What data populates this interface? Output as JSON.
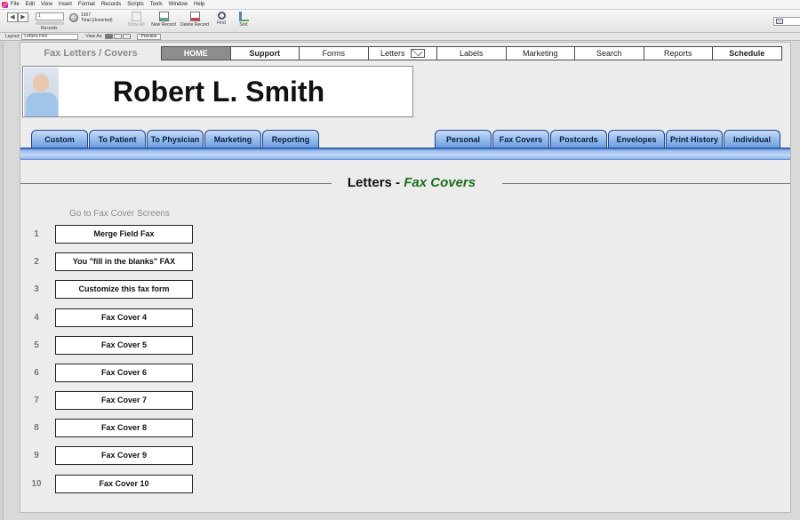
{
  "menu": [
    "File",
    "Edit",
    "View",
    "Insert",
    "Format",
    "Records",
    "Scripts",
    "Tools",
    "Window",
    "Help"
  ],
  "toolbar": {
    "record_number": "1",
    "records_label": "Records",
    "total_count": "1007",
    "total_label": "Total (Unsorted)",
    "show_all": "Show All",
    "new_record": "New Record",
    "delete_record": "Delete Record",
    "find": "Find",
    "sort": "Sort"
  },
  "layoutbar": {
    "layout_label": "Layout:",
    "layout_value": "Letters FAX",
    "view_as_label": "View As:",
    "preview": "Preview"
  },
  "header": {
    "breadcrumb": "Fax Letters / Covers",
    "nav": [
      "HOME",
      "Support",
      "Forms",
      "Letters",
      "Labels",
      "Marketing",
      "Search",
      "Reports",
      "Schedule"
    ]
  },
  "patient": {
    "name": "Robert L. Smith"
  },
  "tabs_left": [
    "Custom",
    "To Patient",
    "To Physician",
    "Marketing",
    "Reporting"
  ],
  "tabs_right": [
    "Personal",
    "Fax Covers",
    "Postcards",
    "Envelopes",
    "Print History",
    "Individual"
  ],
  "section": {
    "title_main": "Letters - ",
    "title_sub": "Fax Covers",
    "subhead": "Go to Fax Cover Screens"
  },
  "fax_covers": [
    {
      "num": "1",
      "label": "Merge Field Fax"
    },
    {
      "num": "2",
      "label": "You \"fill in the blanks\" FAX"
    },
    {
      "num": "3",
      "label": "Customize this fax form"
    },
    {
      "num": "4",
      "label": "Fax Cover 4"
    },
    {
      "num": "5",
      "label": "Fax Cover 5"
    },
    {
      "num": "6",
      "label": "Fax Cover 6"
    },
    {
      "num": "7",
      "label": "Fax Cover 7"
    },
    {
      "num": "8",
      "label": "Fax Cover 8"
    },
    {
      "num": "9",
      "label": "Fax Cover 9"
    },
    {
      "num": "10",
      "label": "Fax Cover 10"
    }
  ]
}
